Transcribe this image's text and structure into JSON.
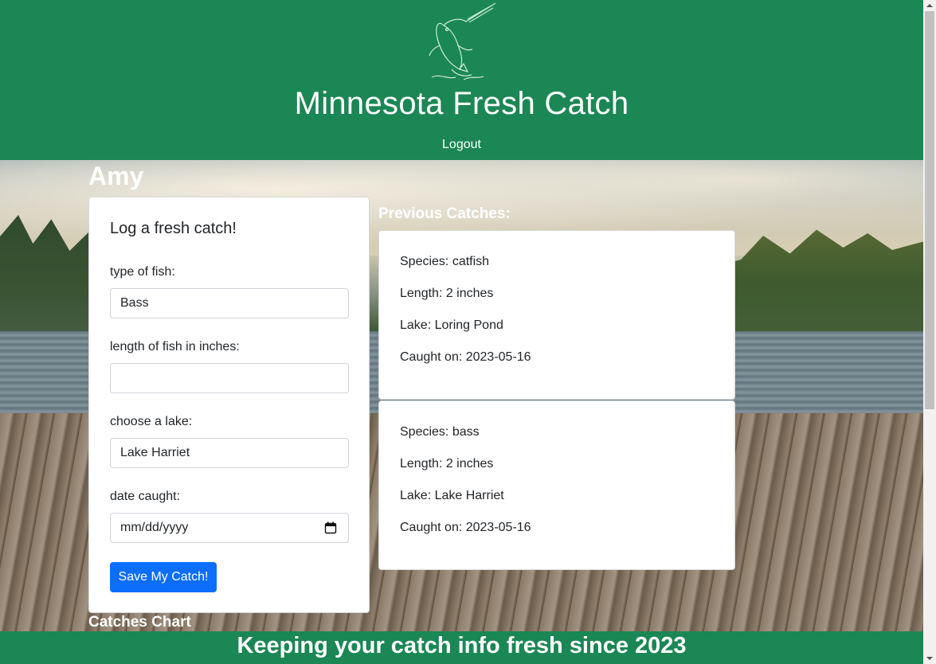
{
  "header": {
    "logo_icon": "leaping-fish-icon",
    "title": "Minnesota Fresh Catch",
    "logout_label": "Logout",
    "background_color": "#1b8754"
  },
  "user": {
    "name": "Amy"
  },
  "form": {
    "heading": "Log a fresh catch!",
    "fish_type": {
      "label": "type of fish:",
      "value": "Bass"
    },
    "length": {
      "label": "length of fish in inches:",
      "value": ""
    },
    "lake": {
      "label": "choose a lake:",
      "value": "Lake Harriet"
    },
    "date": {
      "label": "date caught:",
      "placeholder": "mm/dd/yyyy",
      "icon": "calendar-icon"
    },
    "submit_label": "Save My Catch!",
    "submit_color": "#0d6efd"
  },
  "previous": {
    "title": "Previous Catches:",
    "catches": [
      {
        "species": "Species: catfish",
        "length": "Length: 2 inches",
        "lake": "Lake: Loring Pond",
        "caught_on": "Caught on: 2023-05-16"
      },
      {
        "species": "Species: bass",
        "length": "Length: 2 inches",
        "lake": "Lake: Lake Harriet",
        "caught_on": "Caught on: 2023-05-16"
      }
    ]
  },
  "chart_section": {
    "title": "Catches Chart"
  },
  "footer": {
    "tagline": "Keeping your catch info fresh since 2023"
  }
}
